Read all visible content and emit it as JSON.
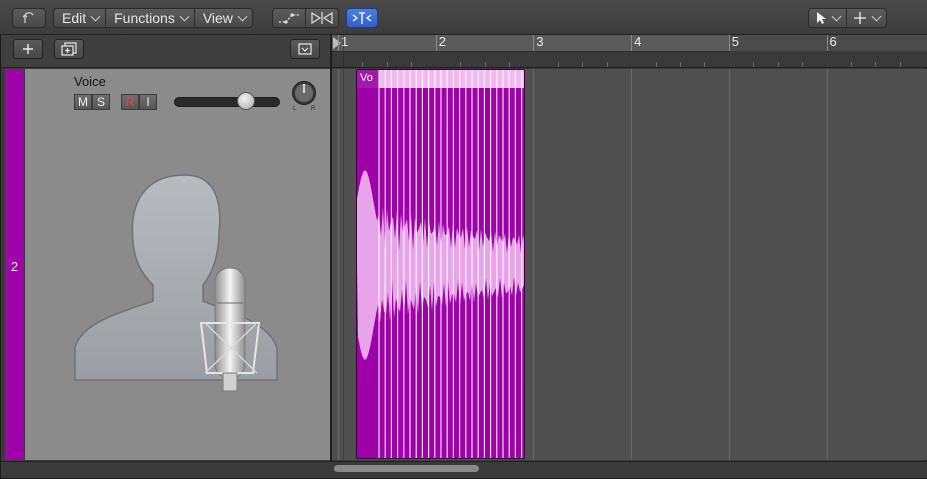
{
  "toolbar": {
    "menus": [
      {
        "label": "Edit"
      },
      {
        "label": "Functions"
      },
      {
        "label": "View"
      }
    ]
  },
  "ruler": {
    "bars": [
      "1",
      "2",
      "3",
      "4",
      "5",
      "6"
    ]
  },
  "track": {
    "number": "2",
    "name": "Voice",
    "buttons": {
      "mute": "M",
      "solo": "S",
      "record": "R",
      "input": "I"
    },
    "volume_level": 0.72,
    "pan_labels": {
      "left": "L",
      "right": "R"
    }
  },
  "region": {
    "name": "Vo",
    "color": "#9e00a8"
  },
  "colors": {
    "track_color": "#a000a8",
    "accent": "#3d6fd1"
  },
  "icons": {
    "back": "back-arrow-icon",
    "automation": "automation-icon",
    "flex": "flex-icon",
    "catch": "catch-icon",
    "pointer": "pointer-tool-icon",
    "marquee": "marquee-tool-icon",
    "add_track": "plus-icon",
    "duplicate_track": "duplicate-track-icon",
    "global_tracks": "global-tracks-icon",
    "avatar": "voice-avatar-icon"
  }
}
